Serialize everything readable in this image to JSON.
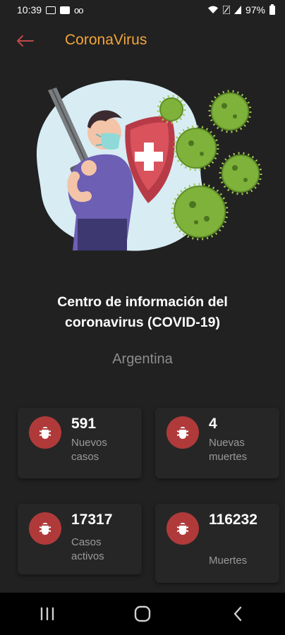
{
  "status_bar": {
    "time": "10:39",
    "battery": "97%"
  },
  "app_bar": {
    "title": "CoronaVirus",
    "back_icon": "arrow-left-icon"
  },
  "colors": {
    "background": "#212121",
    "accent": "#f2a53a",
    "back_arrow": "#c0484a",
    "icon_circle": "#b03a3a",
    "muted_text": "#8c8c8c"
  },
  "main": {
    "headline_line1": "Centro de información del",
    "headline_line2": "coronavirus (COVID-19)",
    "country": "Argentina"
  },
  "stats": [
    {
      "icon": "bug-icon",
      "value": "591",
      "label_line1": "Nuevos",
      "label_line2": "casos"
    },
    {
      "icon": "bug-icon",
      "value": "4",
      "label_line1": "Nuevas",
      "label_line2": "muertes"
    },
    {
      "icon": "bug-icon",
      "value": "17317",
      "label_line1": "Casos",
      "label_line2": "activos"
    },
    {
      "icon": "bug-icon",
      "value": "116232",
      "label_line1": "Muertes",
      "label_line2": ""
    }
  ],
  "nav_bar": {
    "icons": [
      "recent-apps-icon",
      "home-icon",
      "back-icon"
    ]
  }
}
